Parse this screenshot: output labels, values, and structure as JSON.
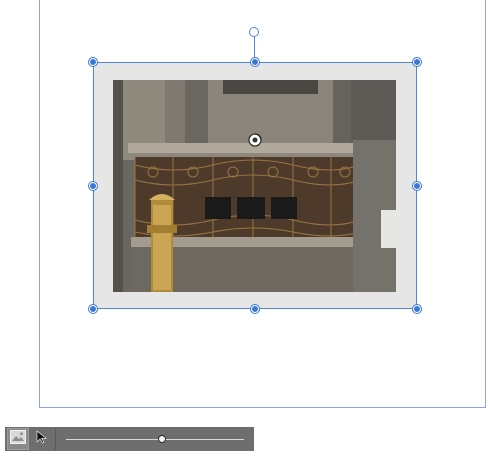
{
  "canvas": {
    "selected_object": "image",
    "accent_color": "#3b78d6"
  },
  "toolbar": {
    "tools": [
      {
        "name": "image-tool",
        "icon": "image-icon",
        "active": true
      },
      {
        "name": "pointer-tool",
        "icon": "pointer-icon",
        "active": false
      }
    ],
    "zoom_slider": {
      "value": 0.54
    }
  },
  "colors": {
    "page_border": "#8ea3ea",
    "frame_fill": "#e6e6e6",
    "selection": "#3b78d6",
    "toolbar_bg": "#6e6e6e"
  }
}
